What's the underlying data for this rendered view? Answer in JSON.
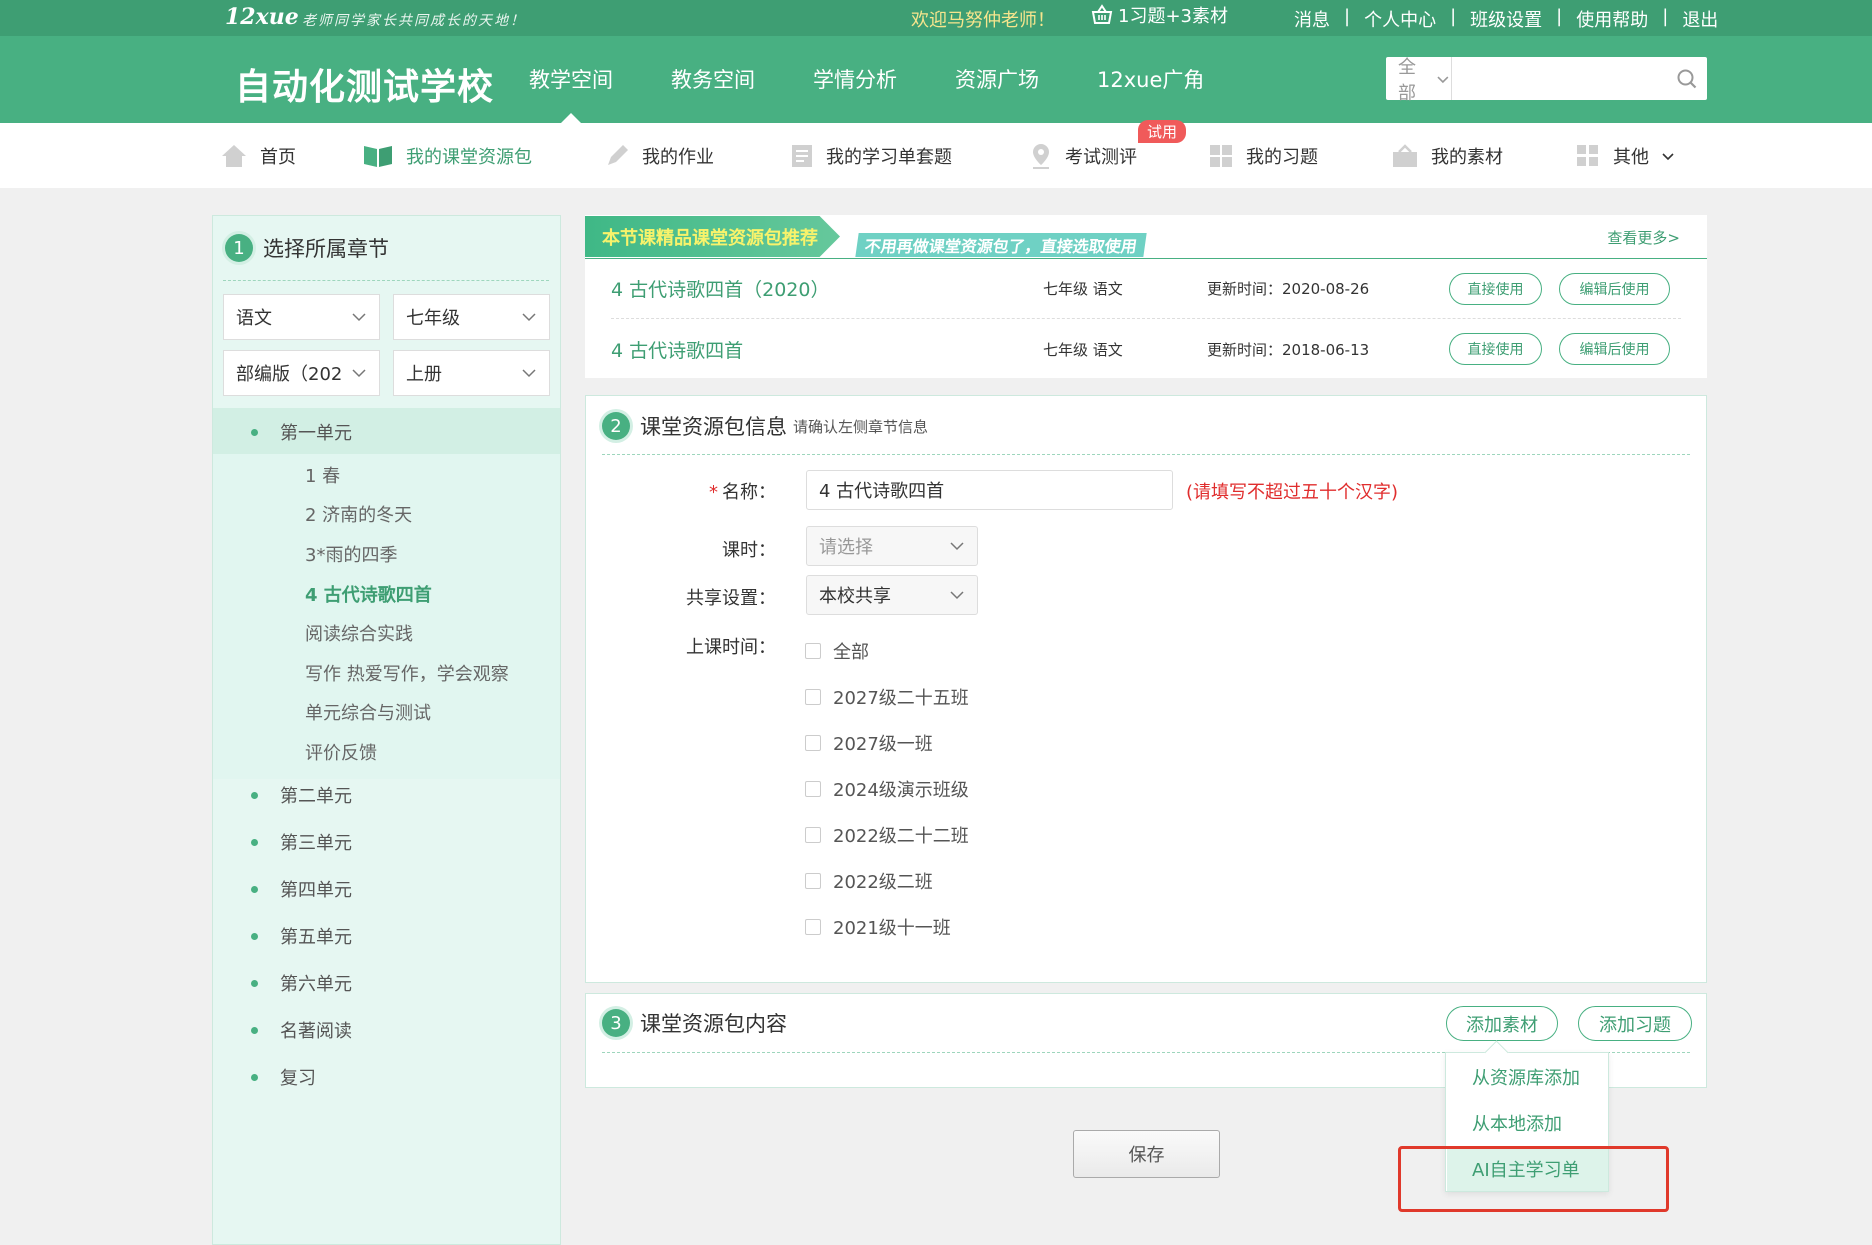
{
  "topbar": {
    "logo": "12xue",
    "slogan": "老师同学家长共同成长的天地！",
    "welcome": "欢迎马努仲老师！",
    "basket": "1习题+3素材",
    "links": [
      "消息",
      "个人中心",
      "班级设置",
      "使用帮助",
      "退出"
    ]
  },
  "navbar": {
    "school": "自动化测试学校",
    "items": [
      "教学空间",
      "教务空间",
      "学情分析",
      "资源广场",
      "12xue广角"
    ],
    "search_scope": "全部",
    "search_value": ""
  },
  "subnav": {
    "items": [
      "首页",
      "我的课堂资源包",
      "我的作业",
      "我的学习单套题",
      "考试测评",
      "我的习题",
      "我的素材",
      "其他"
    ],
    "badge": "试用"
  },
  "left": {
    "num": "1",
    "title": "选择所属章节",
    "subject": "语文",
    "grade": "七年级",
    "edition": "部编版（202",
    "volume": "上册",
    "units_top": [
      "第一单元"
    ],
    "lessons": [
      "1 春",
      "2 济南的冬天",
      "3*雨的四季",
      "4 古代诗歌四首",
      "阅读综合实践",
      "写作 热爱写作，学会观察",
      "单元综合与测试",
      "评价反馈"
    ],
    "units_bottom": [
      "第二单元",
      "第三单元",
      "第四单元",
      "第五单元",
      "第六单元",
      "名著阅读",
      "复习"
    ]
  },
  "recommend": {
    "tag": "本节课精品课堂资源包推荐",
    "sub": "不用再做课堂资源包了，直接选取使用",
    "more": "查看更多>",
    "rows": [
      {
        "title": "4 古代诗歌四首（2020）",
        "grade": "七年级 语文",
        "updated": "更新时间：2020-08-26",
        "use": "直接使用",
        "edit": "编辑后使用"
      },
      {
        "title": "4 古代诗歌四首",
        "grade": "七年级 语文",
        "updated": "更新时间：2018-06-13",
        "use": "直接使用",
        "edit": "编辑后使用"
      }
    ]
  },
  "info": {
    "num": "2",
    "title": "课堂资源包信息",
    "subtitle": "请确认左侧章节信息",
    "req": "*",
    "name_label": "名称：",
    "name_value": "4 古代诗歌四首",
    "name_hint": "(请填写不超过五十个汉字)",
    "period_label": "课时：",
    "period_placeholder": "请选择",
    "share_label": "共享设置：",
    "share_value": "本校共享",
    "time_label": "上课时间：",
    "classes": [
      "全部",
      "2027级二十五班",
      "2027级一班",
      "2024级演示班级",
      "2022级二十二班",
      "2022级二班",
      "2021级十一班"
    ]
  },
  "content": {
    "num": "3",
    "title": "课堂资源包内容",
    "add_material": "添加素材",
    "add_question": "添加习题",
    "menu": [
      "从资源库添加",
      "从本地添加",
      "AI自主学习单"
    ]
  },
  "save_label": "保存",
  "colors": {
    "green": "#48b082",
    "dark_green": "#3e9e73",
    "red": "#e0392b",
    "yellow": "#f6e58d"
  }
}
